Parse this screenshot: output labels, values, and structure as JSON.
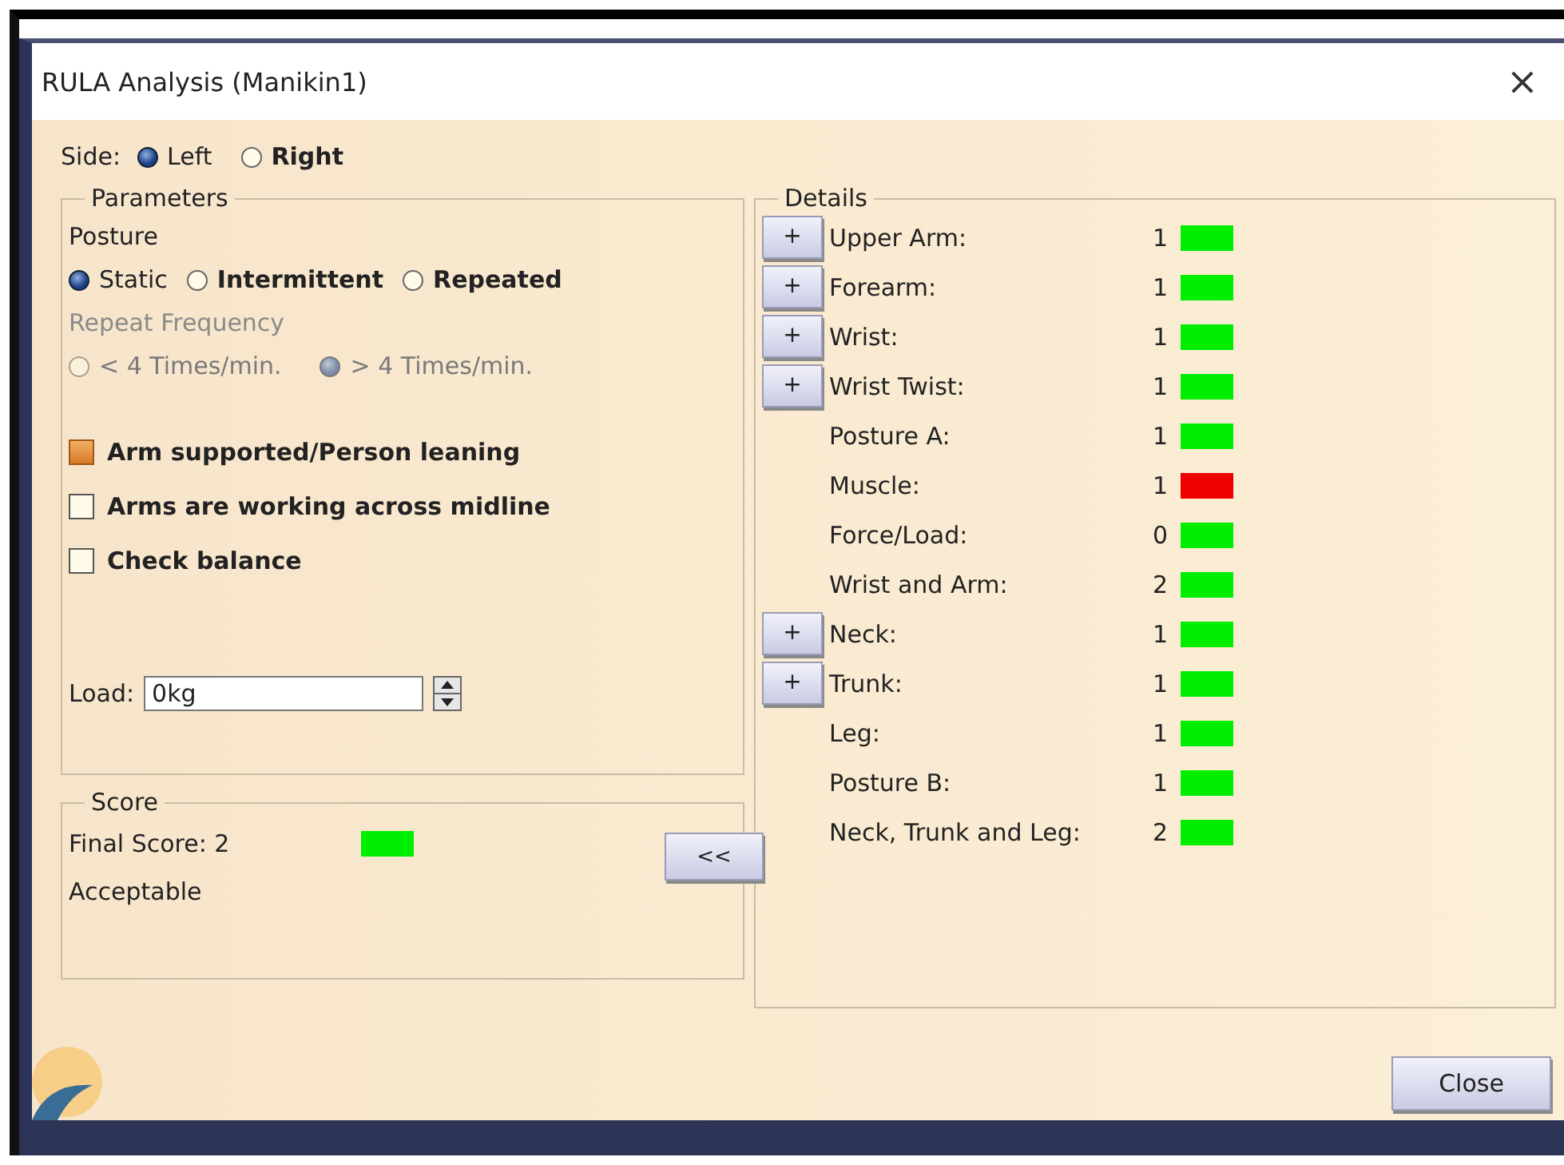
{
  "window": {
    "title": "RULA Analysis (Manikin1)",
    "close": "×"
  },
  "side": {
    "label": "Side:",
    "options": [
      {
        "label": "Left",
        "selected": true
      },
      {
        "label": "Right",
        "selected": false
      }
    ]
  },
  "parameters": {
    "title": "Parameters",
    "posture_label": "Posture",
    "posture": [
      {
        "label": "Static",
        "selected": true
      },
      {
        "label": "Intermittent",
        "selected": false
      },
      {
        "label": "Repeated",
        "selected": false
      }
    ],
    "frequency_label": "Repeat Frequency",
    "frequency_disabled": true,
    "frequency": [
      {
        "label": "< 4 Times/min.",
        "selected": false
      },
      {
        "label": "> 4 Times/min.",
        "selected": true
      }
    ],
    "checks": [
      {
        "label": "Arm supported/Person leaning",
        "checked": true
      },
      {
        "label": "Arms are working across midline",
        "checked": false
      },
      {
        "label": "Check balance",
        "checked": false
      }
    ],
    "load": {
      "label": "Load:",
      "value": "0kg"
    }
  },
  "score": {
    "title": "Score",
    "final": "Final Score: 2",
    "color": "#00ee00",
    "verdict": "Acceptable",
    "toggle": "<<"
  },
  "details": {
    "title": "Details",
    "rows": [
      {
        "button": "+",
        "label": "Upper Arm:",
        "value": "1",
        "color": "#00ee00"
      },
      {
        "button": "+",
        "label": "Forearm:",
        "value": "1",
        "color": "#00ee00"
      },
      {
        "button": "+",
        "label": "Wrist:",
        "value": "1",
        "color": "#00ee00"
      },
      {
        "button": "+",
        "label": "Wrist Twist:",
        "value": "1",
        "color": "#00ee00"
      },
      {
        "label": "Posture A:",
        "value": "1",
        "color": "#00ee00"
      },
      {
        "label": "Muscle:",
        "value": "1",
        "color": "#ee0000"
      },
      {
        "label": "Force/Load:",
        "value": "0",
        "color": "#00ee00"
      },
      {
        "label": "Wrist and Arm:",
        "value": "2",
        "color": "#00ee00"
      },
      {
        "button": "+",
        "label": "Neck:",
        "value": "1",
        "color": "#00ee00"
      },
      {
        "button": "+",
        "label": "Trunk:",
        "value": "1",
        "color": "#00ee00"
      },
      {
        "label": "Leg:",
        "value": "1",
        "color": "#00ee00"
      },
      {
        "label": "Posture B:",
        "value": "1",
        "color": "#00ee00"
      },
      {
        "label": "Neck, Trunk and Leg:",
        "value": "2",
        "color": "#00ee00"
      }
    ]
  },
  "buttons": {
    "close": "Close"
  }
}
